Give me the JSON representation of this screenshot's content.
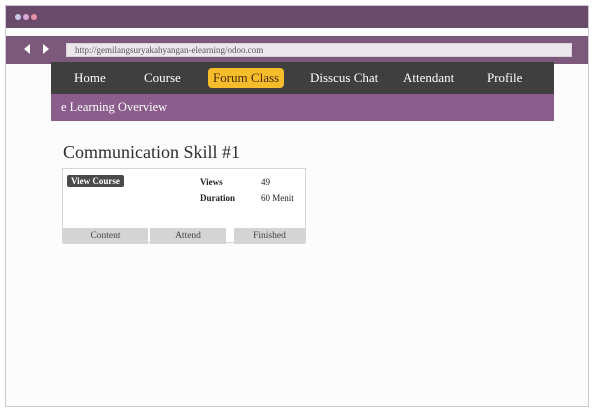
{
  "browser": {
    "url": "http://gemilangsuryakahyangan-elearning/odoo.com"
  },
  "menu": {
    "items": [
      "Home",
      "Course",
      "Forum Class",
      "Disscus Chat",
      "Attendant",
      "Profile"
    ],
    "active_index": 2
  },
  "subheader": {
    "title": "e Learning Overview"
  },
  "course": {
    "title": "Communication Skill #1",
    "view_button": "View Course",
    "stats": [
      {
        "label": "Views",
        "value": "49"
      },
      {
        "label": "Duration",
        "value": "60 Menit"
      }
    ],
    "tabs": [
      "Content",
      "Attend",
      "Finished"
    ]
  },
  "colors": {
    "titlebar": "#6a4a6b",
    "addressbar": "#7b587c",
    "menubar": "#3f3f3f",
    "active_menu": "#f5bd2b",
    "subheader": "#8b5d8c"
  }
}
